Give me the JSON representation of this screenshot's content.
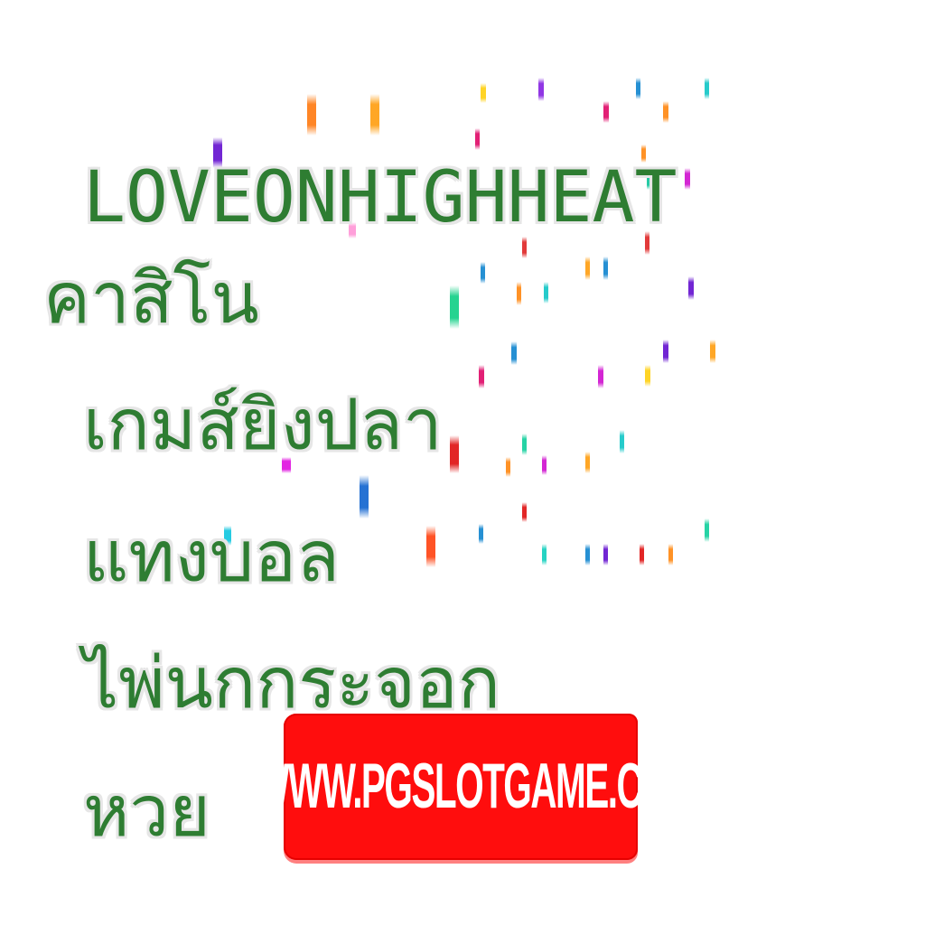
{
  "brand": {
    "name": "LOVEONHIGHHEAT"
  },
  "nav": {
    "casino": "คาสิโน",
    "fish_shooting": "เกมส์ยิงปลา",
    "football_betting": "แทงบอล",
    "card_game": "ไพ่นกกระจอก",
    "lottery": "หวย"
  },
  "cta": {
    "url_label": "WWW.PGSLOTGAME.CC"
  },
  "colors": {
    "text_green": "#2e7d32",
    "text_outline": "#e6e6e6",
    "button_red": "#ff0d0d",
    "button_text": "#ffffff"
  }
}
